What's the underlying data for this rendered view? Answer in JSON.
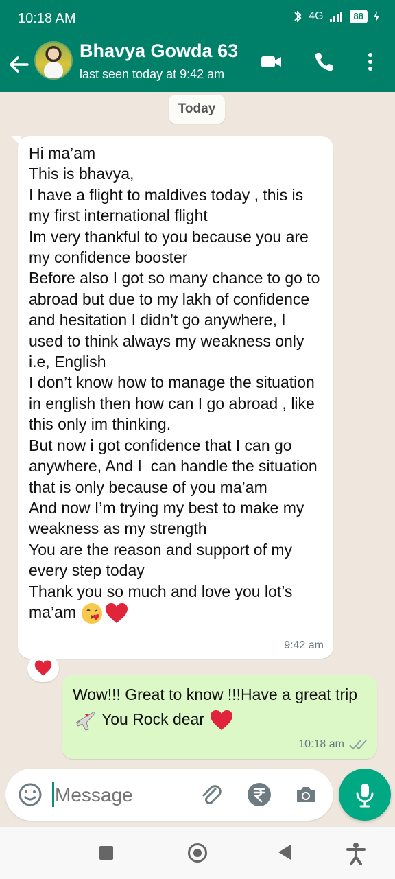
{
  "status_bar": {
    "time": "10:18 AM",
    "network": "4G",
    "battery": "88"
  },
  "header": {
    "contact_name": "Bhavya Gowda 63",
    "last_seen": "last seen today at 9:42 am"
  },
  "chat": {
    "date_chip": "Today",
    "incoming": {
      "text": "Hi ma’am\nThis is bhavya,\nI have a flight to maldives today , this is my first international flight\nIm very thankful to you because you are my confidence booster\nBefore also I got so many chance to go to abroad but due to my lakh of confidence and hesitation I didn’t go anywhere, I used to think always my weakness only i.e, English\nI don’t know how to manage the situation in english then how can I go abroad , like this only im thinking.\nBut now i got confidence that I can go anywhere, And I  can handle the situation that is only because of you ma’am\nAnd now I’m trying my best to make my weakness as my strength\nYou are the reason and support of my every step today\nThank you so much and love you lot’s ma’am",
      "time": "9:42 am"
    },
    "outgoing": {
      "text_before": "Wow!!! Great to know !!!Have a great trip",
      "text_after": "You Rock dear",
      "time": "10:18 am"
    }
  },
  "composer": {
    "placeholder": "Message"
  },
  "colors": {
    "header": "#008069",
    "outgoing_bubble": "#dcf8c6",
    "incoming_bubble": "#ffffff",
    "accent": "#00a884",
    "heart": "#e0243a"
  },
  "icons": [
    "back-arrow-icon",
    "video-call-icon",
    "voice-call-icon",
    "more-options-icon",
    "emoji-icon",
    "attachment-icon",
    "rupee-icon",
    "camera-icon",
    "microphone-icon"
  ]
}
